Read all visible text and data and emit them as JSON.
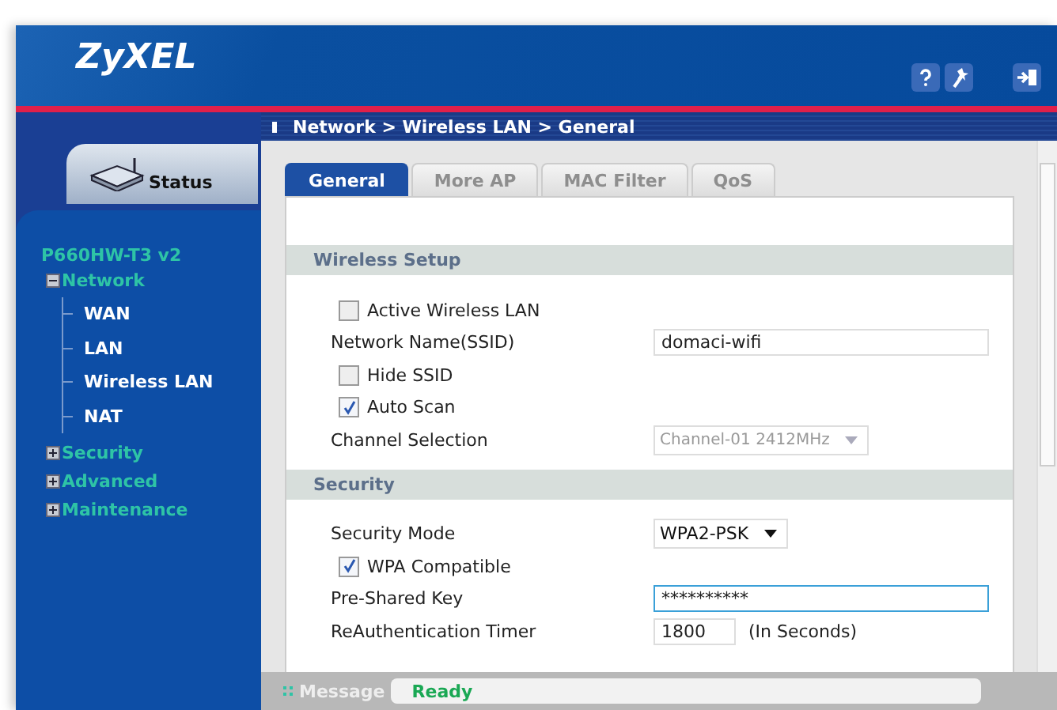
{
  "header": {
    "logo": "ZyXEL"
  },
  "breadcrumb": "Network > Wireless LAN > General",
  "sidebar": {
    "status_tab": "Status",
    "model": "P660HW-T3 v2",
    "tree": [
      {
        "label": "Network",
        "expanded": true,
        "children": [
          {
            "label": "WAN"
          },
          {
            "label": "LAN"
          },
          {
            "label": "Wireless LAN"
          },
          {
            "label": "NAT"
          }
        ]
      },
      {
        "label": "Security",
        "expanded": false
      },
      {
        "label": "Advanced",
        "expanded": false
      },
      {
        "label": "Maintenance",
        "expanded": false
      }
    ]
  },
  "tabs": [
    {
      "label": "General",
      "selected": true
    },
    {
      "label": "More AP",
      "selected": false
    },
    {
      "label": "MAC Filter",
      "selected": false
    },
    {
      "label": "QoS",
      "selected": false
    }
  ],
  "sections": [
    {
      "title": "Wireless Setup",
      "rows": [
        {
          "kind": "checkbox",
          "label": "Active Wireless LAN",
          "checked": false
        },
        {
          "kind": "text",
          "label": "Network Name(SSID)",
          "value": "domaci-wifi"
        },
        {
          "kind": "checkbox",
          "label": "Hide SSID",
          "checked": false
        },
        {
          "kind": "checkbox",
          "label": "Auto Scan",
          "checked": true
        },
        {
          "kind": "select",
          "label": "Channel Selection",
          "value": "Channel-01 2412MHz",
          "disabled": true
        }
      ]
    },
    {
      "title": "Security",
      "rows": [
        {
          "kind": "select",
          "label": "Security Mode",
          "value": "WPA2-PSK",
          "disabled": false
        },
        {
          "kind": "checkbox",
          "label": "WPA Compatible",
          "checked": true
        },
        {
          "kind": "text",
          "label": "Pre-Shared Key",
          "value": "**********",
          "focused": true
        },
        {
          "kind": "short",
          "label": "ReAuthentication Timer",
          "value": "1800",
          "unit": "(In Seconds)"
        }
      ]
    }
  ],
  "status_bar": {
    "label": "Message",
    "value": "Ready"
  }
}
